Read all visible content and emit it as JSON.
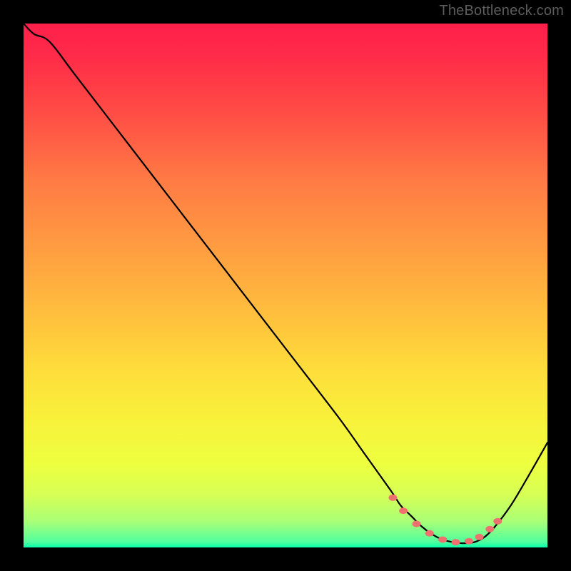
{
  "watermark": "TheBottleneck.com",
  "chart_data": {
    "type": "line",
    "title": "",
    "xlabel": "",
    "ylabel": "",
    "xlim": [
      0,
      100
    ],
    "ylim": [
      0,
      100
    ],
    "grid": false,
    "series": [
      {
        "name": "bottleneck-curve",
        "x": [
          0,
          2,
          5,
          10,
          20,
          30,
          40,
          50,
          60,
          65,
          70,
          72,
          74,
          76,
          78,
          80,
          82,
          84,
          86,
          88,
          90,
          93,
          96,
          100
        ],
        "y": [
          100,
          98,
          96.5,
          90,
          77,
          64,
          51,
          38,
          25,
          18,
          11,
          8,
          6,
          4,
          2.5,
          1.5,
          1,
          0.8,
          1,
          2,
          4,
          8,
          13,
          20
        ]
      }
    ],
    "markers": {
      "name": "optimal-range-dots",
      "color": "#f07070",
      "x": [
        70.5,
        72.5,
        75,
        77.5,
        80,
        82.5,
        85,
        87,
        89,
        90.5
      ],
      "y": [
        9.5,
        7,
        4.5,
        2.7,
        1.5,
        1,
        1.2,
        2,
        3.5,
        5
      ]
    },
    "gradient": {
      "stops": [
        {
          "pos": 0,
          "color": "#ff1f4a"
        },
        {
          "pos": 50,
          "color": "#ffb03f"
        },
        {
          "pos": 75,
          "color": "#f9f03a"
        },
        {
          "pos": 95,
          "color": "#aaff76"
        },
        {
          "pos": 100,
          "color": "#06ffab"
        }
      ]
    }
  }
}
